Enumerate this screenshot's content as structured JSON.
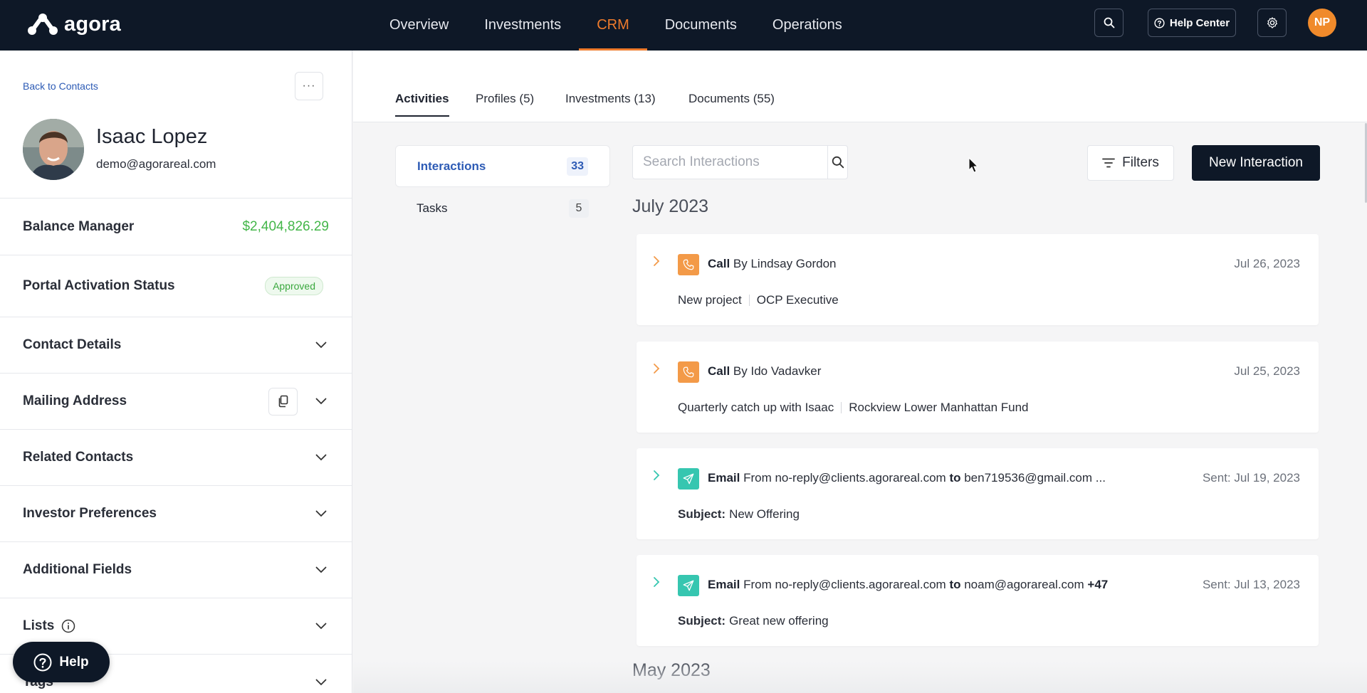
{
  "app": {
    "logo_text": "agora"
  },
  "nav": {
    "items": [
      {
        "label": "Overview"
      },
      {
        "label": "Investments"
      },
      {
        "label": "CRM"
      },
      {
        "label": "Documents"
      },
      {
        "label": "Operations"
      }
    ],
    "active": "CRM"
  },
  "topbar": {
    "help_label": "Help Center",
    "avatar_initials": "NP"
  },
  "contact": {
    "back_label": "Back to Contacts",
    "more_label": "···",
    "name": "Isaac Lopez",
    "email": "demo@agorareal.com",
    "balance_label": "Balance Manager",
    "balance_value": "$2,404,826.29",
    "portal_label": "Portal Activation Status",
    "portal_status": "Approved",
    "sections": [
      {
        "label": "Contact Details"
      },
      {
        "label": "Mailing Address"
      },
      {
        "label": "Related Contacts"
      },
      {
        "label": "Investor Preferences"
      },
      {
        "label": "Additional Fields"
      },
      {
        "label": "Lists"
      },
      {
        "label": "Tags"
      }
    ]
  },
  "help_button": {
    "label": "Help"
  },
  "tabs": [
    {
      "label": "Activities"
    },
    {
      "label": "Profiles (5)"
    },
    {
      "label": "Investments (13)"
    },
    {
      "label": "Documents (55)"
    }
  ],
  "subnav": [
    {
      "label": "Interactions",
      "count": "33"
    },
    {
      "label": "Tasks",
      "count": "5"
    }
  ],
  "search": {
    "placeholder": "Search Interactions"
  },
  "filters_label": "Filters",
  "new_interaction_label": "New Interaction",
  "months": [
    "July 2023",
    "May 2023"
  ],
  "interactions": [
    {
      "type": "call",
      "type_label": "Call",
      "rest": " By Lindsay Gordon",
      "date": "Jul 26, 2023",
      "sub": [
        "New project",
        "OCP Executive"
      ]
    },
    {
      "type": "call",
      "type_label": "Call",
      "rest": " By Ido Vadavker",
      "date": "Jul 25, 2023",
      "sub": [
        "Quarterly catch up with Isaac",
        "Rockview Lower Manhattan Fund"
      ]
    },
    {
      "type": "email",
      "type_label": "Email",
      "from": " From no-reply@clients.agorareal.com ",
      "to_label": "to",
      "to": " ben719536@gmail.com ...",
      "extra": "",
      "date": "Sent: Jul 19, 2023",
      "subject_label": "Subject:",
      "subject": "New Offering"
    },
    {
      "type": "email",
      "type_label": "Email",
      "from": " From no-reply@clients.agorareal.com ",
      "to_label": "to",
      "to": " noam@agorareal.com ",
      "extra": "+47",
      "date": "Sent: Jul 13, 2023",
      "subject_label": "Subject:",
      "subject": "Great new offering"
    }
  ],
  "colors": {
    "accent": "#ee7b2c",
    "navy": "#0e1827",
    "link": "#2d5bb5",
    "positive": "#43b649",
    "call_icon": "#f39a48",
    "email_icon": "#36c6b0"
  }
}
